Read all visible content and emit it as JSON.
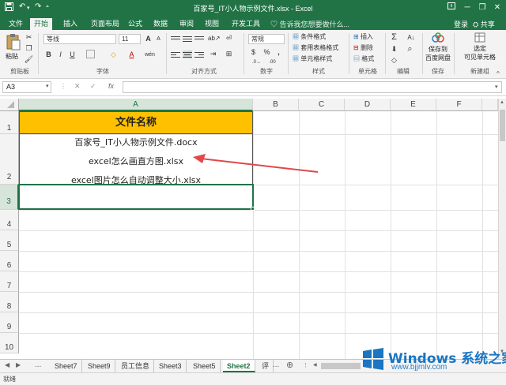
{
  "window": {
    "title": "百家号_IT小人物示例文件.xlsx - Excel"
  },
  "ribbon_tabs": [
    "文件",
    "开始",
    "插入",
    "页面布局",
    "公式",
    "数据",
    "审阅",
    "视图",
    "开发工具"
  ],
  "active_tab": "开始",
  "tell_me": "♡ 告诉我您想要做什么...",
  "account": {
    "login": "登录",
    "share": "共享"
  },
  "ribbon": {
    "clipboard": {
      "paste": "粘贴",
      "label": "剪贴板"
    },
    "font": {
      "name": "等线",
      "size": "11",
      "label": "字体",
      "bold": "B",
      "italic": "I",
      "underline": "U",
      "grow": "A",
      "shrink": "A",
      "font_color": "A",
      "fill": "◇",
      "phonetic": "wén"
    },
    "alignment": {
      "label": "对齐方式"
    },
    "number": {
      "format": "常规",
      "label": "数字",
      "currency": "$",
      "percent": "%",
      "comma": ","
    },
    "styles": {
      "conditional": "条件格式",
      "table": "套用表格格式",
      "cell": "单元格样式",
      "label": "样式"
    },
    "cells": {
      "insert": "插入",
      "delete": "删除",
      "format": "格式",
      "label": "单元格"
    },
    "editing": {
      "sum": "Σ",
      "sort": "A↓",
      "find": "⌕",
      "label": "编辑"
    },
    "save": {
      "line1": "保存到",
      "line2": "百度网盘",
      "label": "保存"
    },
    "select": {
      "line1": "选定",
      "line2": "可见单元格",
      "label": "新建组"
    }
  },
  "formula_bar": {
    "name_box": "A3",
    "cancel": "✕",
    "enter": "✓",
    "fx": "fx",
    "value": ""
  },
  "columns": [
    "A",
    "B",
    "C",
    "D",
    "E",
    "F"
  ],
  "rows": [
    "1",
    "2",
    "3",
    "4",
    "5",
    "6",
    "7",
    "8",
    "9",
    "10"
  ],
  "cells": {
    "A1": "文件名称",
    "A2_line1": "百家号_IT小人物示例文件.docx",
    "A2_line2": "excel怎么画直方图.xlsx",
    "A2_line3": "excel图片怎么自动调整大小.xlsx"
  },
  "sheet_tabs": [
    "Sheet7",
    "Sheet9",
    "员工信息",
    "Sheet3",
    "Sheet5",
    "Sheet2",
    "评"
  ],
  "active_sheet": "Sheet2",
  "sheet_nav": {
    "prev": "◀",
    "next": "▶",
    "more": "...",
    "add": "⊕"
  },
  "status": "就绪",
  "watermark": {
    "brand": "Windows 系统之家",
    "url": "www.bjjmlv.com"
  },
  "colors": {
    "accent": "#217346",
    "header_fill": "#ffc000",
    "arrow": "#e04848"
  }
}
